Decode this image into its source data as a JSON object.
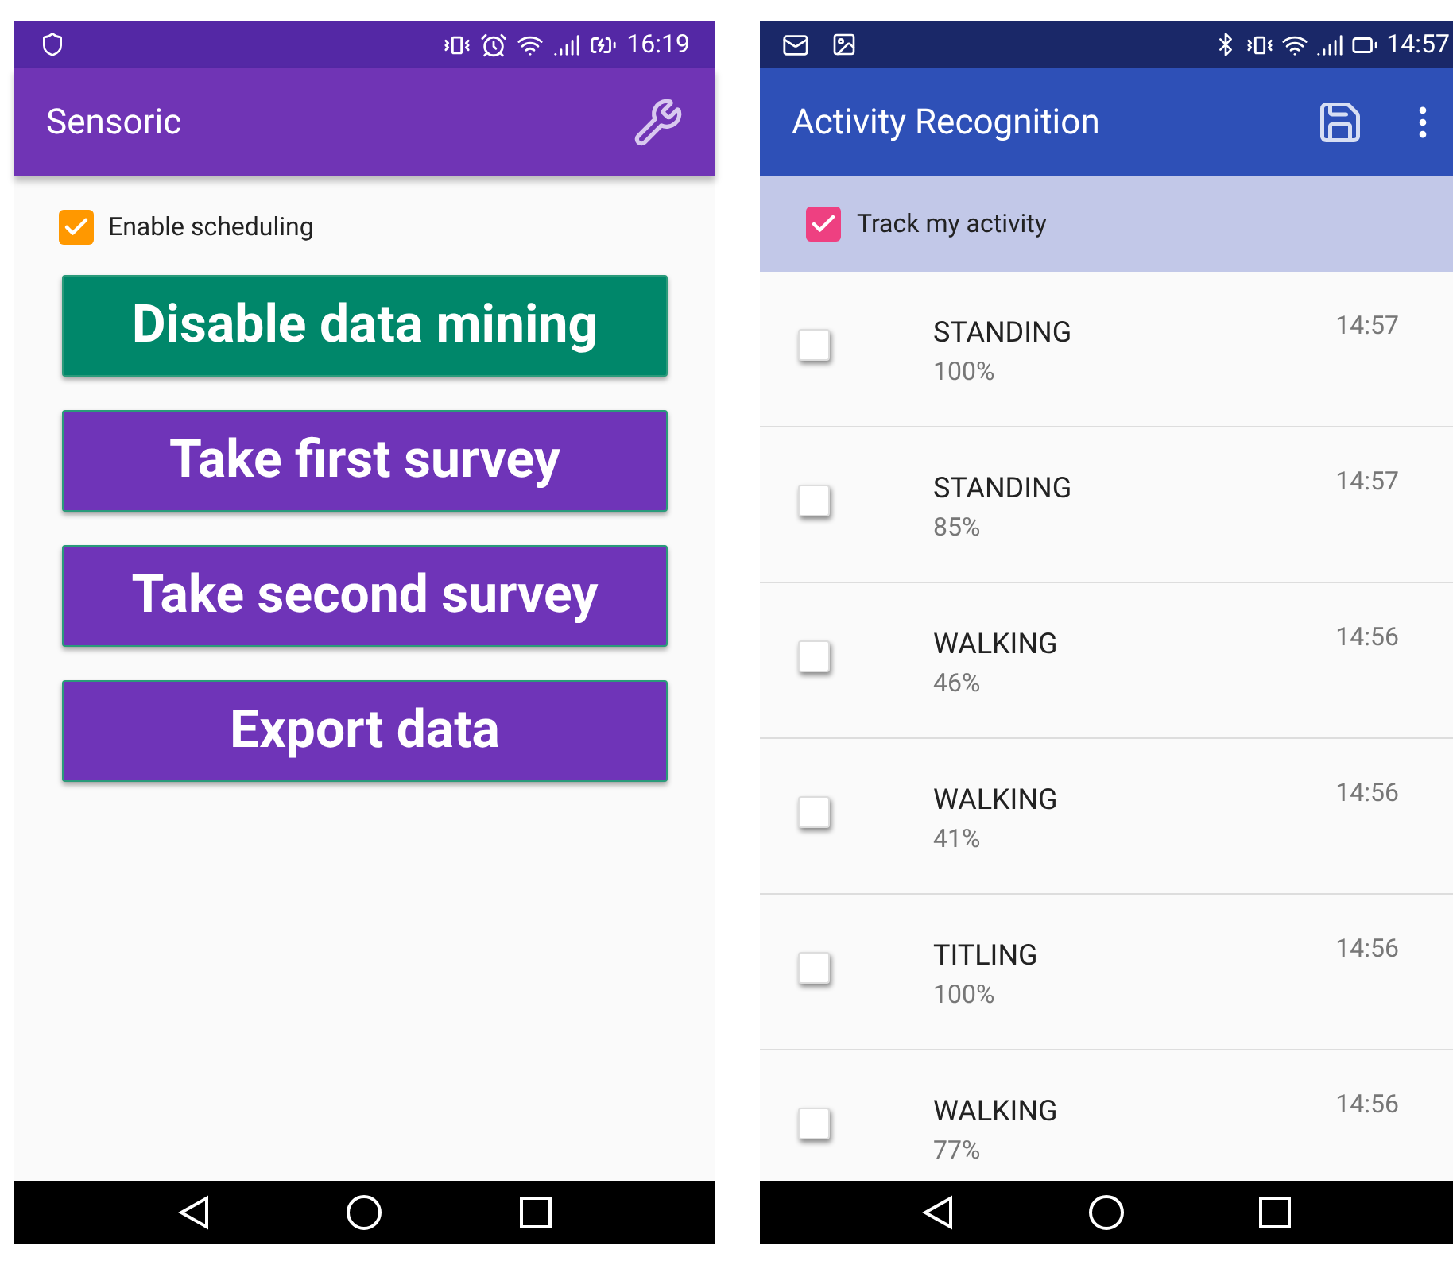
{
  "left_phone": {
    "status_bar": {
      "time": "16:19"
    },
    "app_bar": {
      "title": "Sensoric"
    },
    "scheduling": {
      "label": "Enable scheduling",
      "checked": true
    },
    "buttons": [
      {
        "label": "Disable data mining",
        "color": "#00876a"
      },
      {
        "label": "Take first survey",
        "color": "#6f34b8"
      },
      {
        "label": "Take second survey",
        "color": "#6f34b8"
      },
      {
        "label": "Export data",
        "color": "#6f34b8"
      }
    ]
  },
  "right_phone": {
    "status_bar": {
      "time": "14:57"
    },
    "app_bar": {
      "title": "Activity Recognition"
    },
    "track": {
      "label": "Track my activity",
      "checked": true
    },
    "activities": [
      {
        "name": "STANDING",
        "confidence": "100%",
        "time": "14:57",
        "checked": false
      },
      {
        "name": "STANDING",
        "confidence": "85%",
        "time": "14:57",
        "checked": false
      },
      {
        "name": "WALKING",
        "confidence": "46%",
        "time": "14:56",
        "checked": false
      },
      {
        "name": "WALKING",
        "confidence": "41%",
        "time": "14:56",
        "checked": false
      },
      {
        "name": "TITLING",
        "confidence": "100%",
        "time": "14:56",
        "checked": false
      },
      {
        "name": "WALKING",
        "confidence": "77%",
        "time": "14:56",
        "checked": false
      }
    ]
  }
}
